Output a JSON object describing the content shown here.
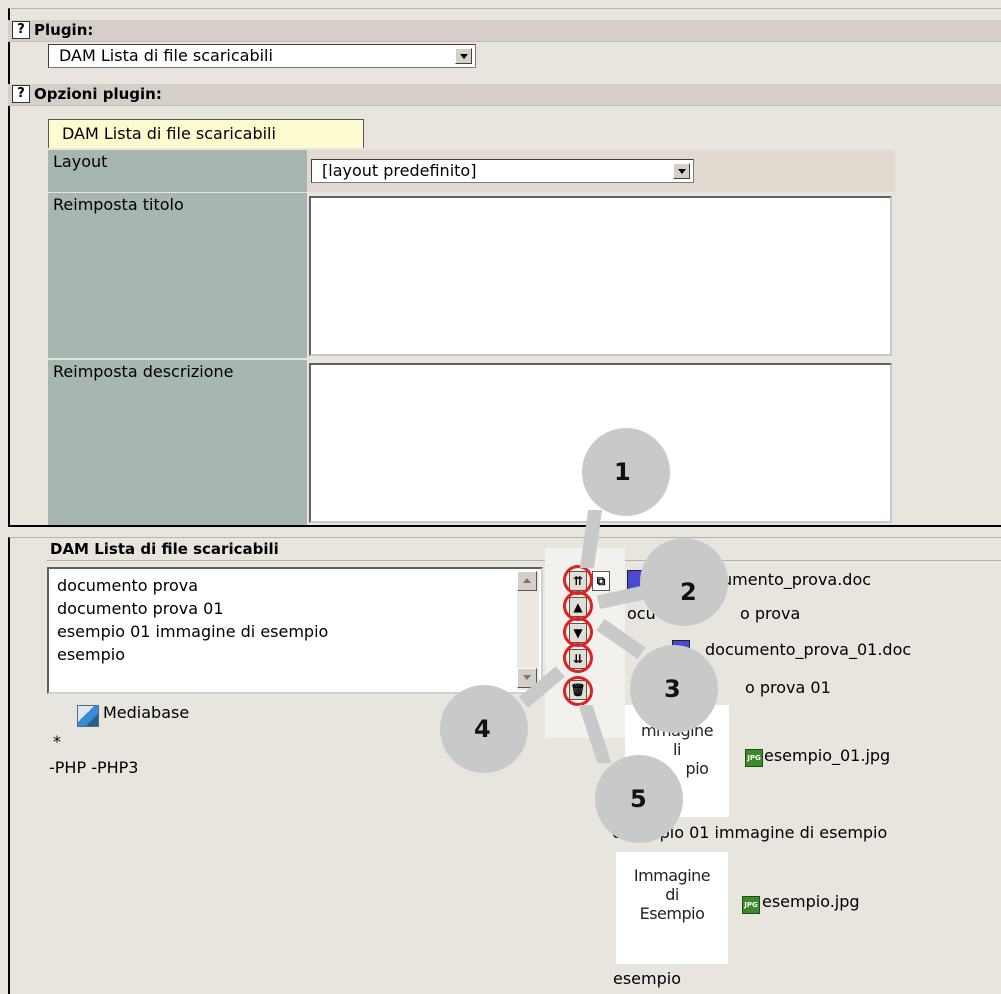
{
  "plugin": {
    "label": "Plugin:",
    "selected": "DAM Lista di file scaricabili"
  },
  "options": {
    "label": "Opzioni plugin:",
    "tab": "DAM Lista di file scaricabili",
    "layout_label": "Layout",
    "layout_selected": "[layout predefinito]",
    "title_label": "Reimposta titolo",
    "desc_label": "Reimposta descrizione"
  },
  "files": {
    "section_title": "DAM Lista di file scaricabili",
    "list": [
      "documento prova",
      "documento prova 01",
      "esempio 01 immagine di esempio",
      "esempio"
    ],
    "mediabase": "Mediabase",
    "asterisk": "*",
    "extensions": "-PHP -PHP3",
    "entries": [
      {
        "file": "umento_prova.doc",
        "caption": "o prova"
      },
      {
        "file": "documento_prova_01.doc",
        "caption": "o prova 01"
      },
      {
        "file": "esempio_01.jpg",
        "caption": "mpio 01 immagine di esempio",
        "thumb": [
          "mmagine",
          "li",
          "pio"
        ]
      },
      {
        "file": "esempio.jpg",
        "caption": "esempio",
        "thumb": [
          "Immagine",
          "di",
          "Esempio"
        ]
      }
    ],
    "prefix_doc1": "ocu",
    "caption2_prefix": "",
    "caption3_prefix": "e"
  },
  "callouts": [
    "1",
    "2",
    "3",
    "4",
    "5"
  ],
  "colors": {
    "callout": "#c9c9c9",
    "highlight": "#e12020",
    "label_cell": "#a7b6b1",
    "tab_bg": "#fffbd0"
  }
}
